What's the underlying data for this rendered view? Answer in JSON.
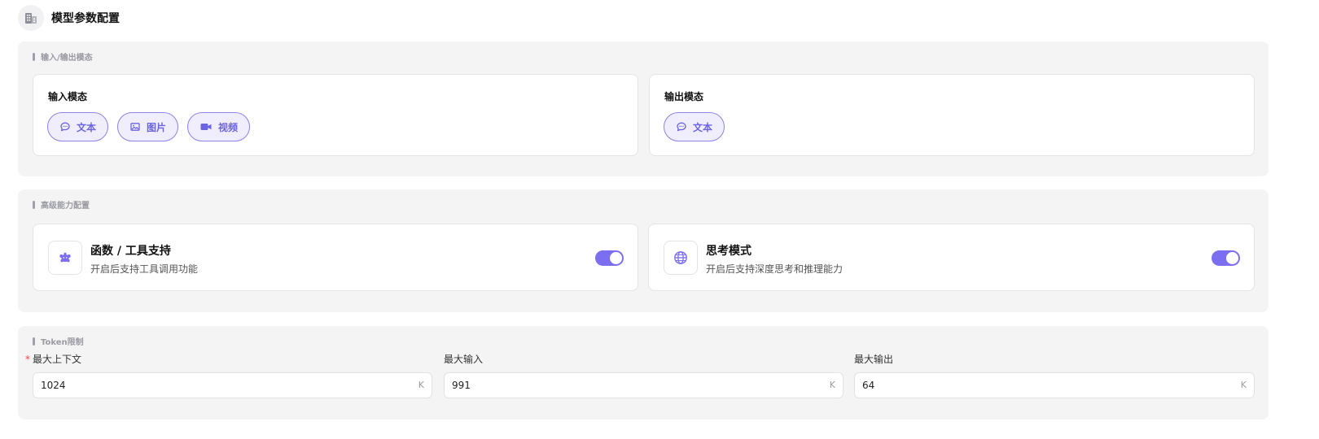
{
  "header": {
    "title": "模型参数配置",
    "icon": "building-icon"
  },
  "modality": {
    "section_label": "输入/输出模态",
    "input": {
      "title": "输入模态",
      "chips": [
        {
          "label": "文本",
          "icon": "chat-bubble-icon"
        },
        {
          "label": "图片",
          "icon": "image-icon"
        },
        {
          "label": "视频",
          "icon": "video-camera-icon"
        }
      ]
    },
    "output": {
      "title": "输出模态",
      "chips": [
        {
          "label": "文本",
          "icon": "chat-bubble-icon"
        }
      ]
    }
  },
  "advanced": {
    "section_label": "高级能力配置",
    "items": [
      {
        "title": "函数 / 工具支持",
        "description": "开启后支持工具调用功能",
        "icon": "tools-icon",
        "enabled": true
      },
      {
        "title": "思考模式",
        "description": "开启后支持深度思考和推理能力",
        "icon": "globe-icon",
        "enabled": true
      }
    ]
  },
  "tokens": {
    "section_label": "Token限制",
    "fields": [
      {
        "label": "最大上下文",
        "required": true,
        "value": "1024",
        "unit": "K"
      },
      {
        "label": "最大输入",
        "required": false,
        "value": "991",
        "unit": "K"
      },
      {
        "label": "最大输出",
        "required": false,
        "value": "64",
        "unit": "K"
      }
    ]
  },
  "colors": {
    "accent": "#7b6ef0",
    "chip_bg": "#f0eefd",
    "panel_bg": "#f4f4f5",
    "required": "#e5484d"
  }
}
